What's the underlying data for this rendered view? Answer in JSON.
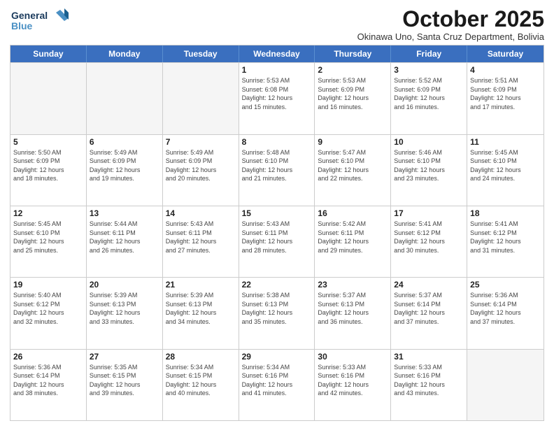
{
  "logo": {
    "line1": "General",
    "line2": "Blue"
  },
  "title": "October 2025",
  "subtitle": "Okinawa Uno, Santa Cruz Department, Bolivia",
  "weekdays": [
    "Sunday",
    "Monday",
    "Tuesday",
    "Wednesday",
    "Thursday",
    "Friday",
    "Saturday"
  ],
  "rows": [
    [
      {
        "day": "",
        "info": "",
        "empty": true
      },
      {
        "day": "",
        "info": "",
        "empty": true
      },
      {
        "day": "",
        "info": "",
        "empty": true
      },
      {
        "day": "1",
        "info": "Sunrise: 5:53 AM\nSunset: 6:08 PM\nDaylight: 12 hours\nand 15 minutes."
      },
      {
        "day": "2",
        "info": "Sunrise: 5:53 AM\nSunset: 6:09 PM\nDaylight: 12 hours\nand 16 minutes."
      },
      {
        "day": "3",
        "info": "Sunrise: 5:52 AM\nSunset: 6:09 PM\nDaylight: 12 hours\nand 16 minutes."
      },
      {
        "day": "4",
        "info": "Sunrise: 5:51 AM\nSunset: 6:09 PM\nDaylight: 12 hours\nand 17 minutes."
      }
    ],
    [
      {
        "day": "5",
        "info": "Sunrise: 5:50 AM\nSunset: 6:09 PM\nDaylight: 12 hours\nand 18 minutes."
      },
      {
        "day": "6",
        "info": "Sunrise: 5:49 AM\nSunset: 6:09 PM\nDaylight: 12 hours\nand 19 minutes."
      },
      {
        "day": "7",
        "info": "Sunrise: 5:49 AM\nSunset: 6:09 PM\nDaylight: 12 hours\nand 20 minutes."
      },
      {
        "day": "8",
        "info": "Sunrise: 5:48 AM\nSunset: 6:10 PM\nDaylight: 12 hours\nand 21 minutes."
      },
      {
        "day": "9",
        "info": "Sunrise: 5:47 AM\nSunset: 6:10 PM\nDaylight: 12 hours\nand 22 minutes."
      },
      {
        "day": "10",
        "info": "Sunrise: 5:46 AM\nSunset: 6:10 PM\nDaylight: 12 hours\nand 23 minutes."
      },
      {
        "day": "11",
        "info": "Sunrise: 5:45 AM\nSunset: 6:10 PM\nDaylight: 12 hours\nand 24 minutes."
      }
    ],
    [
      {
        "day": "12",
        "info": "Sunrise: 5:45 AM\nSunset: 6:10 PM\nDaylight: 12 hours\nand 25 minutes."
      },
      {
        "day": "13",
        "info": "Sunrise: 5:44 AM\nSunset: 6:11 PM\nDaylight: 12 hours\nand 26 minutes."
      },
      {
        "day": "14",
        "info": "Sunrise: 5:43 AM\nSunset: 6:11 PM\nDaylight: 12 hours\nand 27 minutes."
      },
      {
        "day": "15",
        "info": "Sunrise: 5:43 AM\nSunset: 6:11 PM\nDaylight: 12 hours\nand 28 minutes."
      },
      {
        "day": "16",
        "info": "Sunrise: 5:42 AM\nSunset: 6:11 PM\nDaylight: 12 hours\nand 29 minutes."
      },
      {
        "day": "17",
        "info": "Sunrise: 5:41 AM\nSunset: 6:12 PM\nDaylight: 12 hours\nand 30 minutes."
      },
      {
        "day": "18",
        "info": "Sunrise: 5:41 AM\nSunset: 6:12 PM\nDaylight: 12 hours\nand 31 minutes."
      }
    ],
    [
      {
        "day": "19",
        "info": "Sunrise: 5:40 AM\nSunset: 6:12 PM\nDaylight: 12 hours\nand 32 minutes."
      },
      {
        "day": "20",
        "info": "Sunrise: 5:39 AM\nSunset: 6:13 PM\nDaylight: 12 hours\nand 33 minutes."
      },
      {
        "day": "21",
        "info": "Sunrise: 5:39 AM\nSunset: 6:13 PM\nDaylight: 12 hours\nand 34 minutes."
      },
      {
        "day": "22",
        "info": "Sunrise: 5:38 AM\nSunset: 6:13 PM\nDaylight: 12 hours\nand 35 minutes."
      },
      {
        "day": "23",
        "info": "Sunrise: 5:37 AM\nSunset: 6:13 PM\nDaylight: 12 hours\nand 36 minutes."
      },
      {
        "day": "24",
        "info": "Sunrise: 5:37 AM\nSunset: 6:14 PM\nDaylight: 12 hours\nand 37 minutes."
      },
      {
        "day": "25",
        "info": "Sunrise: 5:36 AM\nSunset: 6:14 PM\nDaylight: 12 hours\nand 37 minutes."
      }
    ],
    [
      {
        "day": "26",
        "info": "Sunrise: 5:36 AM\nSunset: 6:14 PM\nDaylight: 12 hours\nand 38 minutes."
      },
      {
        "day": "27",
        "info": "Sunrise: 5:35 AM\nSunset: 6:15 PM\nDaylight: 12 hours\nand 39 minutes."
      },
      {
        "day": "28",
        "info": "Sunrise: 5:34 AM\nSunset: 6:15 PM\nDaylight: 12 hours\nand 40 minutes."
      },
      {
        "day": "29",
        "info": "Sunrise: 5:34 AM\nSunset: 6:16 PM\nDaylight: 12 hours\nand 41 minutes."
      },
      {
        "day": "30",
        "info": "Sunrise: 5:33 AM\nSunset: 6:16 PM\nDaylight: 12 hours\nand 42 minutes."
      },
      {
        "day": "31",
        "info": "Sunrise: 5:33 AM\nSunset: 6:16 PM\nDaylight: 12 hours\nand 43 minutes."
      },
      {
        "day": "",
        "info": "",
        "empty": true
      }
    ]
  ]
}
